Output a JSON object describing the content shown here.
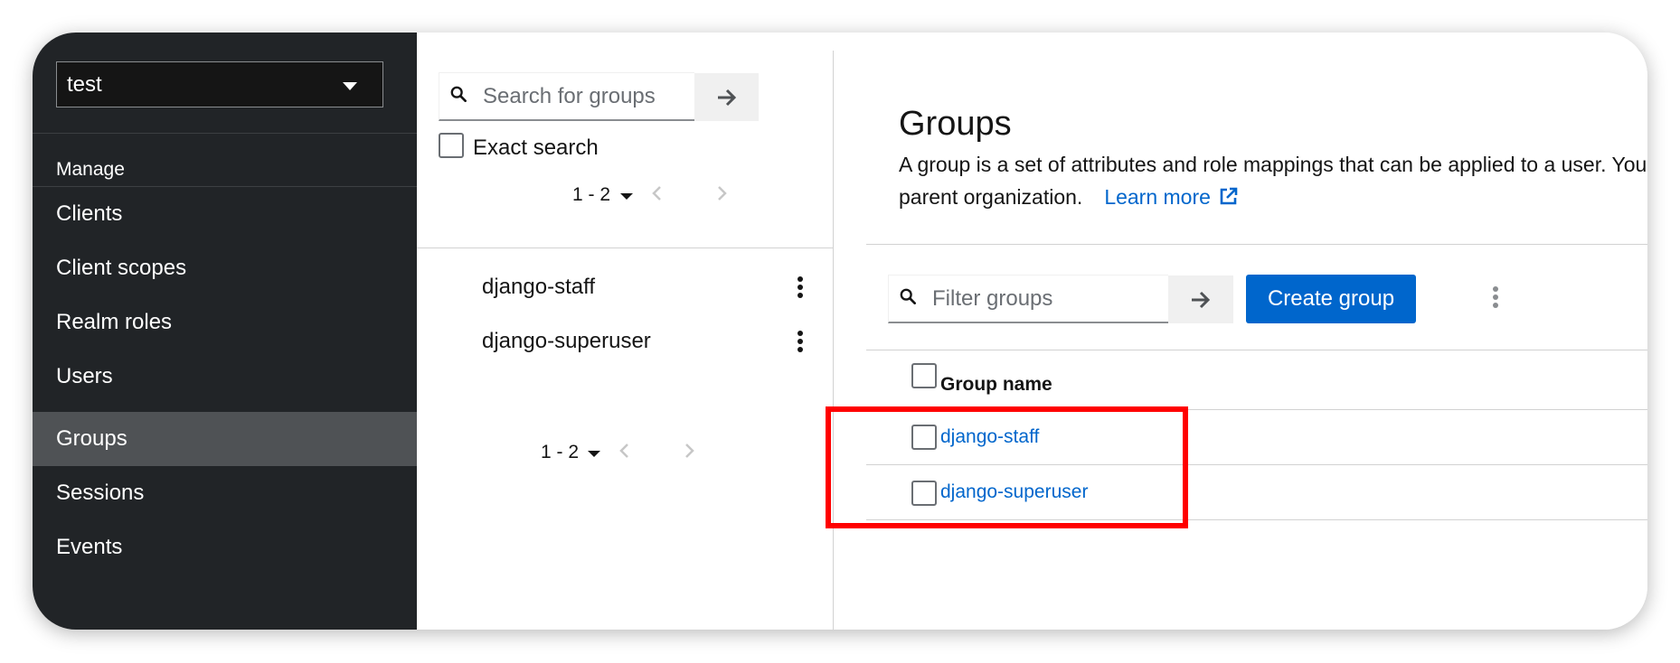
{
  "sidebar": {
    "realm_selector": "test",
    "section_label": "Manage",
    "items": [
      {
        "label": "Clients"
      },
      {
        "label": "Client scopes"
      },
      {
        "label": "Realm roles"
      },
      {
        "label": "Users"
      },
      {
        "label": "Groups",
        "active": true
      },
      {
        "label": "Sessions"
      },
      {
        "label": "Events"
      }
    ]
  },
  "tree_panel": {
    "search_placeholder": "Search for groups",
    "exact_search_label": "Exact search",
    "pagination_top": "1 - 2",
    "pagination_bottom": "1 - 2",
    "groups": [
      "django-staff",
      "django-superuser"
    ]
  },
  "main": {
    "title": "Groups",
    "description_line1": "A group is a set of attributes and role mappings that can be applied to a user. You",
    "description_line2": "parent organization.",
    "learn_more": "Learn more",
    "filter_placeholder": "Filter groups",
    "create_button": "Create group",
    "table": {
      "column_header": "Group name",
      "rows": [
        "django-staff",
        "django-superuser"
      ]
    }
  },
  "colors": {
    "sidebar_bg": "#212427",
    "active_nav_bg": "#4f5255",
    "accent": "#0066cc",
    "highlight": "#ff0000"
  }
}
